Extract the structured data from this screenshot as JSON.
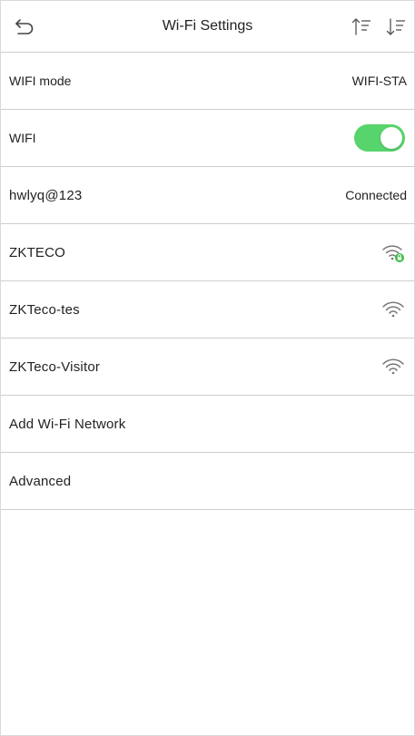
{
  "header": {
    "title": "Wi-Fi Settings",
    "back_icon": "back-arrow-icon",
    "sort_asc_icon": "sort-ascending-icon",
    "sort_desc_icon": "sort-descending-icon"
  },
  "rows": {
    "wifi_mode": {
      "label": "WIFI mode",
      "value": "WIFI-STA"
    },
    "wifi_toggle": {
      "label": "WIFI",
      "on": true
    },
    "connected_network": {
      "label": "hwlyq@123",
      "status": "Connected"
    },
    "network_1": {
      "label": "ZKTECO",
      "icon": "wifi-locked-icon"
    },
    "network_2": {
      "label": "ZKTeco-tes",
      "icon": "wifi-icon"
    },
    "network_3": {
      "label": "ZKTeco-Visitor",
      "icon": "wifi-icon"
    },
    "add_network": {
      "label": "Add Wi-Fi Network"
    },
    "advanced": {
      "label": "Advanced"
    }
  },
  "colors": {
    "toggle_on": "#57d46b",
    "lock_badge": "#3dbb4a",
    "divider": "#cfcfcf"
  }
}
